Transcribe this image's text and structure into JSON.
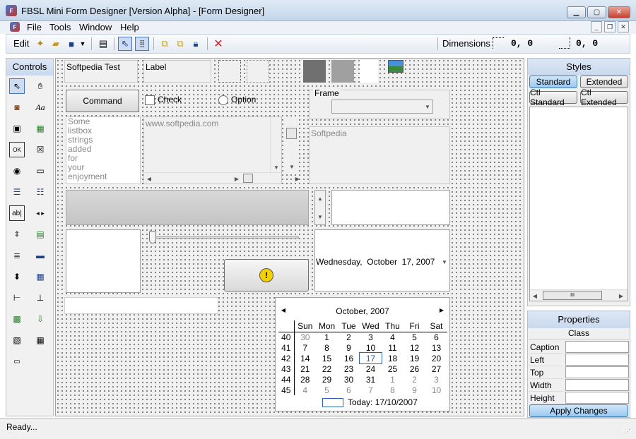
{
  "window": {
    "title": "FBSL Mini Form Designer [Version Alpha] - [Form Designer]",
    "app_icon": "app-icon"
  },
  "menu": [
    "File",
    "Tools",
    "Window",
    "Help"
  ],
  "toolbar": {
    "edit_label": "Edit",
    "dimensions_label": "Dimensions",
    "pos_value": "0, 0",
    "size_value": "0, 0"
  },
  "controls_panel": {
    "title": "Controls"
  },
  "form": {
    "textbox1": "Softpedia Test",
    "label1": "Label",
    "command": "Command",
    "check": "Check",
    "option": "Option",
    "frame": "Frame",
    "listbox_items": [
      "Some",
      "listbox",
      "strings",
      "added",
      "for",
      "your",
      "enjoyment"
    ],
    "textarea_text": "www.softpedia.com",
    "richtext_text": "Softpedia",
    "date_picker": {
      "day": "Wednesday,",
      "month": "October",
      "date": "17, 2007"
    },
    "calendar": {
      "month_title": "October, 2007",
      "weekdays": [
        "Sun",
        "Mon",
        "Tue",
        "Wed",
        "Thu",
        "Fri",
        "Sat"
      ],
      "weeks": [
        {
          "wk": "40",
          "days": [
            "30",
            "1",
            "2",
            "3",
            "4",
            "5",
            "6"
          ]
        },
        {
          "wk": "41",
          "days": [
            "7",
            "8",
            "9",
            "10",
            "11",
            "12",
            "13"
          ]
        },
        {
          "wk": "42",
          "days": [
            "14",
            "15",
            "16",
            "17",
            "18",
            "19",
            "20"
          ]
        },
        {
          "wk": "43",
          "days": [
            "21",
            "22",
            "23",
            "24",
            "25",
            "26",
            "27"
          ]
        },
        {
          "wk": "44",
          "days": [
            "28",
            "29",
            "30",
            "31",
            "1",
            "2",
            "3"
          ]
        },
        {
          "wk": "45",
          "days": [
            "4",
            "5",
            "6",
            "7",
            "8",
            "9",
            "10"
          ]
        }
      ],
      "today_label": "Today: 17/10/2007"
    }
  },
  "styles_panel": {
    "title": "Styles",
    "buttons": [
      "Standard",
      "Extended",
      "Ctl Standard",
      "Ctl Extended"
    ],
    "scroll_grip": "III"
  },
  "properties_panel": {
    "title": "Properties",
    "class_label": "Class",
    "rows": [
      "Caption",
      "Left",
      "Top",
      "Width",
      "Height"
    ],
    "apply": "Apply Changes"
  },
  "status": "Ready...",
  "colors": {
    "accent": "#2a62b3",
    "swatch_dark": "#707070",
    "swatch_mid": "#a0a0a0",
    "swatch_light": "#ffffff"
  }
}
